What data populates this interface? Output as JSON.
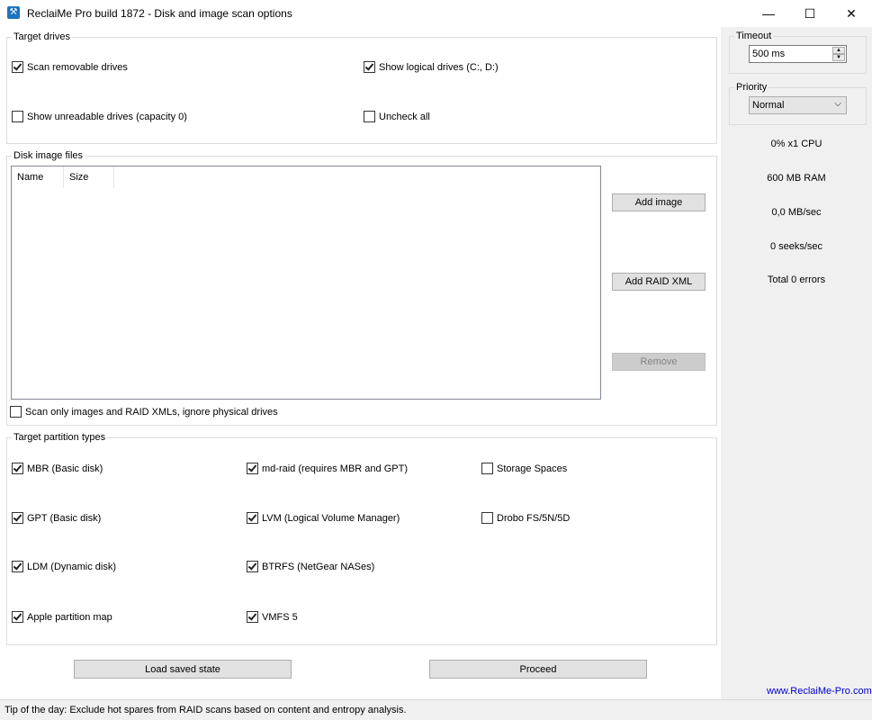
{
  "window": {
    "title": "ReclaiMe Pro build 1872 - Disk and image scan options",
    "minimize_glyph": "—",
    "maximize_glyph": "☐",
    "close_glyph": "✕"
  },
  "target_drives": {
    "label": "Target drives",
    "scan_removable": {
      "label": "Scan removable drives",
      "checked": true
    },
    "show_logical": {
      "label": "Show logical drives (C:, D:)",
      "checked": true
    },
    "show_unreadable": {
      "label": "Show unreadable drives (capacity 0)",
      "checked": false
    },
    "uncheck_all": {
      "label": "Uncheck all",
      "checked": false
    }
  },
  "disk_images": {
    "label": "Disk image files",
    "columns": [
      "Name",
      "Size"
    ],
    "add_image": "Add image",
    "add_raid_xml": "Add RAID XML",
    "remove": "Remove",
    "scan_only_images": {
      "label": "Scan only images and RAID XMLs, ignore physical drives",
      "checked": false
    }
  },
  "partition_types": {
    "label": "Target partition types",
    "mbr": {
      "label": "MBR (Basic disk)",
      "checked": true
    },
    "gpt": {
      "label": "GPT (Basic disk)",
      "checked": true
    },
    "ldm": {
      "label": "LDM (Dynamic disk)",
      "checked": true
    },
    "apple": {
      "label": "Apple partition map",
      "checked": true
    },
    "mdraid": {
      "label": "md-raid (requires MBR and GPT)",
      "checked": true
    },
    "lvm": {
      "label": "LVM (Logical Volume Manager)",
      "checked": true
    },
    "btrfs": {
      "label": "BTRFS (NetGear NASes)",
      "checked": true
    },
    "vmfs": {
      "label": "VMFS 5",
      "checked": true
    },
    "storage_spaces": {
      "label": "Storage Spaces",
      "checked": false
    },
    "drobo": {
      "label": "Drobo FS/5N/5D",
      "checked": false
    }
  },
  "actions": {
    "load_saved_state": "Load saved state",
    "proceed": "Proceed"
  },
  "side_panel": {
    "timeout_label": "Timeout",
    "timeout_value": "500 ms",
    "priority_label": "Priority",
    "priority_value": "Normal",
    "cpu": "0% x1 CPU",
    "ram": "600 MB RAM",
    "throughput": "0,0 MB/sec",
    "seeks": "0 seeks/sec",
    "errors": "Total 0 errors",
    "website": "www.ReclaiMe-Pro.com"
  },
  "statusbar": {
    "tip": "Tip of the day: Exclude hot spares from RAID scans based on content and entropy analysis."
  },
  "colors": {
    "panel_bg": "#f0f0f0",
    "link": "#0000cc",
    "disabled_button": "#cccccc"
  }
}
